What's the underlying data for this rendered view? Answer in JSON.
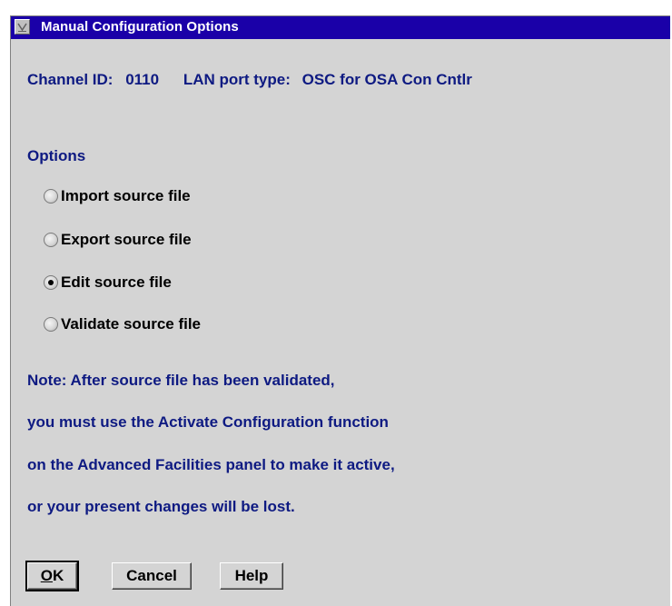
{
  "window": {
    "title": "Manual Configuration Options",
    "system_menu_icon": "chevron-down-icon"
  },
  "info": {
    "channel_label": "Channel ID:",
    "channel_value": "0110",
    "port_label": "LAN port type:",
    "port_value": "OSC for OSA Con Cntlr"
  },
  "options": {
    "heading": "Options",
    "items": [
      {
        "label": "Import source file",
        "selected": false
      },
      {
        "label": "Export source file",
        "selected": false
      },
      {
        "label": "Edit source file",
        "selected": true
      },
      {
        "label": "Validate source file",
        "selected": false
      }
    ]
  },
  "note": {
    "lines": [
      "Note: After source file has been validated,",
      "you must use the Activate Configuration function",
      "on the Advanced Facilities panel to make it active,",
      "or your present changes will be lost."
    ]
  },
  "buttons": {
    "ok_mnemonic": "O",
    "ok_rest": "K",
    "cancel": "Cancel",
    "help": "Help"
  },
  "colors": {
    "titlebar": "#1a00a8",
    "dialog_bg": "#d4d4d4",
    "text_accent": "#0e1a82"
  }
}
